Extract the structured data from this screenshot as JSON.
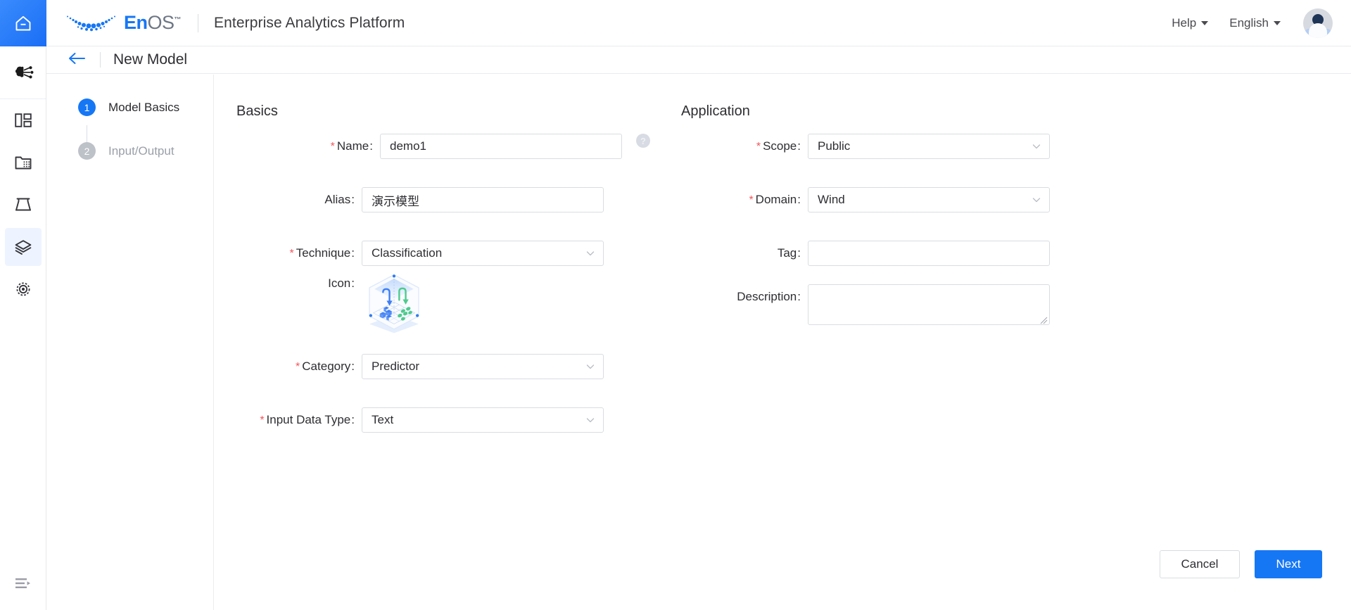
{
  "header": {
    "logo_text_primary": "En",
    "logo_text_secondary": "OS",
    "logo_tm": "™",
    "app_title": "Enterprise Analytics Platform",
    "help_label": "Help",
    "language_label": "English"
  },
  "page_header": {
    "title": "New Model"
  },
  "rail": {
    "items": [
      {
        "name": "home-icon",
        "label": "Home"
      },
      {
        "name": "ai-model-icon",
        "label": "AI Model"
      },
      {
        "name": "dashboard-icon",
        "label": "Dashboard"
      },
      {
        "name": "data-folder-icon",
        "label": "Data"
      },
      {
        "name": "lab-flask-icon",
        "label": "Lab"
      },
      {
        "name": "model-serving-icon",
        "label": "Model Serving"
      },
      {
        "name": "settings-eye-icon",
        "label": "Monitoring"
      }
    ],
    "collapse_label": "Collapse"
  },
  "steps": [
    {
      "num": "1",
      "label": "Model Basics",
      "state": "active"
    },
    {
      "num": "2",
      "label": "Input/Output",
      "state": "idle"
    }
  ],
  "basics": {
    "section_title": "Basics",
    "name": {
      "label": "Name",
      "required": true,
      "value": "demo1",
      "placeholder": ""
    },
    "alias": {
      "label": "Alias",
      "required": false,
      "value": "演示模型",
      "placeholder": ""
    },
    "technique": {
      "label": "Technique",
      "required": true,
      "value": "Classification"
    },
    "icon": {
      "label": "Icon",
      "required": false,
      "alt": "model-icon-hexagon-cube"
    },
    "category": {
      "label": "Category",
      "required": true,
      "value": "Predictor"
    },
    "input_data_type": {
      "label": "Input Data Type",
      "required": true,
      "value": "Text"
    },
    "help_glyph": "?"
  },
  "application": {
    "section_title": "Application",
    "scope": {
      "label": "Scope",
      "required": true,
      "value": "Public"
    },
    "domain": {
      "label": "Domain",
      "required": true,
      "value": "Wind"
    },
    "tag": {
      "label": "Tag",
      "required": false,
      "value": "",
      "placeholder": ""
    },
    "description": {
      "label": "Description",
      "required": false,
      "value": "",
      "placeholder": ""
    }
  },
  "footer": {
    "cancel_label": "Cancel",
    "next_label": "Next"
  },
  "colors": {
    "accent": "#1677f5",
    "required_asterisk": "#f5565c",
    "border": "#d9dce1",
    "text": "#2e2e33",
    "muted_text": "#9aa0a8",
    "rail_active_bg": "#eef4ff",
    "icon_blue": "#3d7ef5",
    "icon_green": "#4ecb8d"
  }
}
